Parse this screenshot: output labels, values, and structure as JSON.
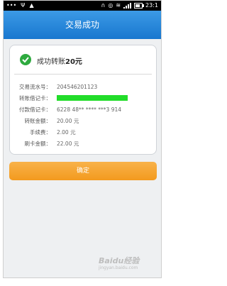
{
  "status": {
    "left_icons": [
      "ellipsis",
      "usb",
      "android"
    ],
    "time": "23:1"
  },
  "header": {
    "title": "交易成功"
  },
  "result": {
    "message": "成功转账",
    "amount": "20元"
  },
  "details": [
    {
      "label": "交易流水号：",
      "value": "204546201123"
    },
    {
      "label": "转账借记卡：",
      "value": ""
    },
    {
      "label": "付款借记卡：",
      "value": "6228 48** **** ***3 914"
    },
    {
      "label": "转账金额：",
      "value": "20.00 元"
    },
    {
      "label": "手续费：",
      "value": "2.00 元"
    },
    {
      "label": "刷卡金额：",
      "value": "22.00 元"
    }
  ],
  "actions": {
    "confirm_label": "确定"
  },
  "watermark": {
    "brand": "Baidu经验",
    "domain": "jingyan.baidu.com"
  },
  "colors": {
    "header": "#1a7fd6",
    "success": "#2eaa3f",
    "confirm": "#f5a12b",
    "redacted_bar": "#22dd2a"
  }
}
